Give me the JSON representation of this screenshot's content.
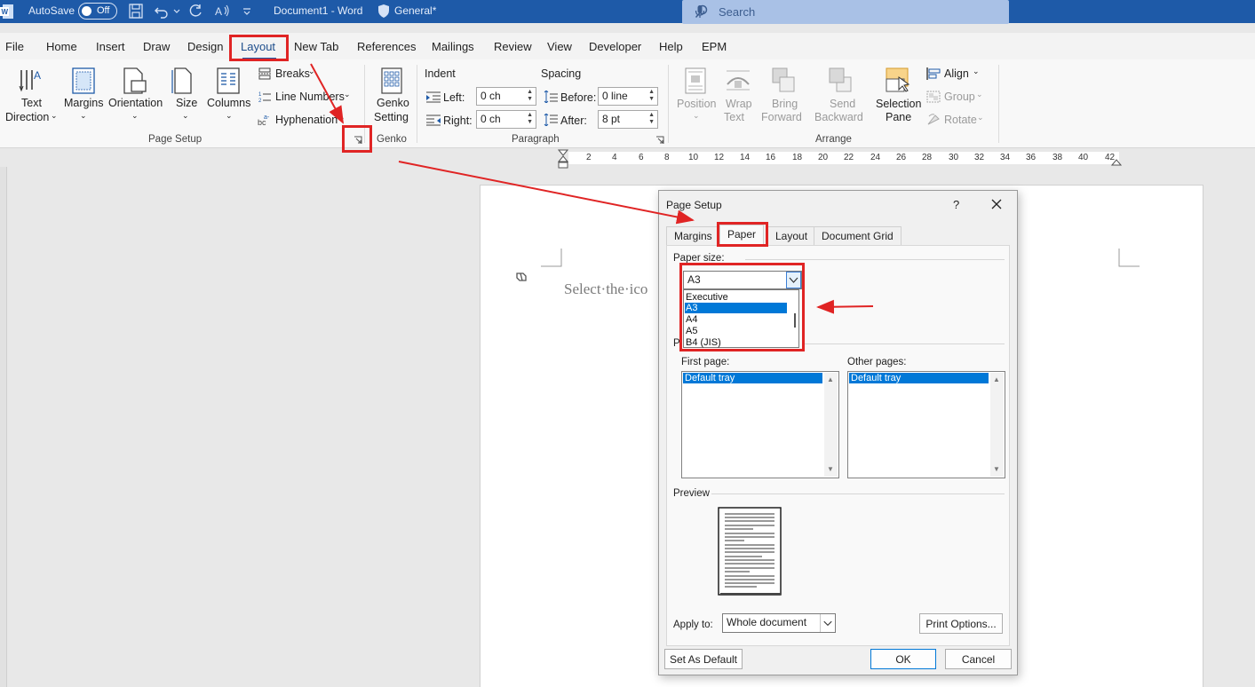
{
  "titlebar": {
    "autosave_label": "AutoSave",
    "autosave_state": "Off",
    "document_title": "Document1 - Word",
    "sensitivity_label": "General*",
    "search_placeholder": "Search"
  },
  "menu": {
    "tabs": [
      "File",
      "Home",
      "Insert",
      "Draw",
      "Design",
      "Layout",
      "New Tab",
      "References",
      "Mailings",
      "Review",
      "View",
      "Developer",
      "Help",
      "EPM"
    ],
    "active": "Layout"
  },
  "ribbon": {
    "page_setup": {
      "group_label": "Page Setup",
      "text_direction": [
        "Text",
        "Direction"
      ],
      "margins": "Margins",
      "orientation": "Orientation",
      "size": "Size",
      "columns": "Columns",
      "breaks": "Breaks",
      "line_numbers": "Line Numbers",
      "hyphenation": "Hyphenation"
    },
    "genko": {
      "group_label": "Genko",
      "button": [
        "Genko",
        "Setting"
      ]
    },
    "paragraph": {
      "group_label": "Paragraph",
      "indent_label": "Indent",
      "spacing_label": "Spacing",
      "left_label": "Left:",
      "left_value": "0 ch",
      "right_label": "Right:",
      "right_value": "0 ch",
      "before_label": "Before:",
      "before_value": "0 line",
      "after_label": "After:",
      "after_value": "8 pt"
    },
    "arrange": {
      "group_label": "Arrange",
      "position": "Position",
      "wrap_text": [
        "Wrap",
        "Text"
      ],
      "bring_forward": [
        "Bring",
        "Forward"
      ],
      "send_backward": [
        "Send",
        "Backward"
      ],
      "selection_pane": [
        "Selection",
        "Pane"
      ],
      "align": "Align",
      "group": "Group",
      "rotate": "Rotate"
    }
  },
  "ruler": {
    "ticks": [
      "2",
      "4",
      "6",
      "8",
      "10",
      "12",
      "14",
      "16",
      "18",
      "20",
      "22",
      "24",
      "26",
      "28",
      "30",
      "32",
      "34",
      "36",
      "38",
      "40",
      "42"
    ]
  },
  "document": {
    "placeholder_text": "Select·the·ico"
  },
  "dialog": {
    "title": "Page Setup",
    "help": "?",
    "tabs": [
      "Margins",
      "Paper",
      "Layout",
      "Document Grid"
    ],
    "active_tab": "Paper",
    "paper_size_label": "Paper size:",
    "paper_size_value": "A3",
    "paper_size_options": [
      "Executive",
      "A3",
      "A4",
      "A5",
      "B4 (JIS)"
    ],
    "paper_size_selected": "A3",
    "paper_source_label_fragment": "P",
    "first_page_label": "First page:",
    "first_page_options": [
      "Default tray"
    ],
    "other_pages_label": "Other pages:",
    "other_pages_options": [
      "Default tray"
    ],
    "preview_label": "Preview",
    "apply_to_label": "Apply to:",
    "apply_to_value": "Whole document",
    "print_options_button": "Print Options...",
    "set_default_button": "Set As Default",
    "ok_button": "OK",
    "cancel_button": "Cancel"
  },
  "colors": {
    "title_bar": "#1e5aa8",
    "accent": "#0078d7",
    "annotation": "#e02424"
  }
}
